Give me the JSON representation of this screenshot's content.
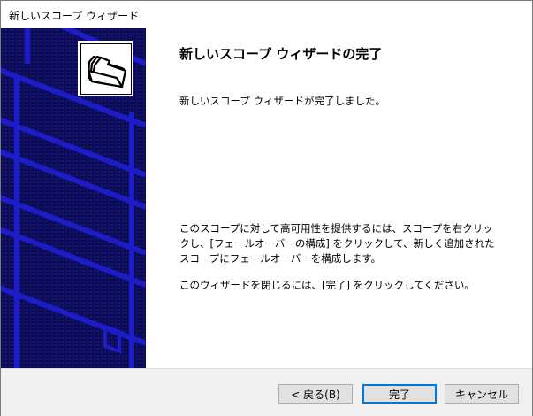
{
  "window": {
    "title": "新しいスコープ ウィザード"
  },
  "page": {
    "heading": "新しいスコープ ウィザードの完了",
    "message_complete": "新しいスコープ ウィザードが完了しました。",
    "message_failover": "このスコープに対して高可用性を提供するには、スコープを右クリックし、[フェールオーバーの構成] をクリックして、新しく追加されたスコープにフェールオーバーを構成します。",
    "message_close": "このウィザードを閉じるには、[完了] をクリックしてください。"
  },
  "buttons": {
    "back": "< 戻る(B)",
    "finish": "完了",
    "cancel": "キャンセル"
  },
  "colors": {
    "banner_bg": "#0b0b57",
    "banner_lines": "#1c1cc8",
    "default_button_border": "#0078d7"
  },
  "icons": {
    "wizard_logo": "folders-icon"
  }
}
